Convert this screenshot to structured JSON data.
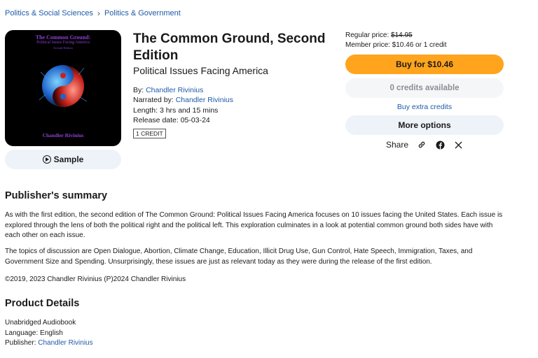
{
  "breadcrumb": [
    "Politics & Social Sciences",
    "Politics & Government"
  ],
  "cover": {
    "title_line1": "The Common Ground:",
    "title_line2": "Political Issues Facing America",
    "title_line3": "Second Edition",
    "author": "Chandler Rivinius"
  },
  "sample_label": "Sample",
  "book": {
    "title": "The Common Ground, Second Edition",
    "subtitle": "Political Issues Facing America",
    "by_label": "By: ",
    "author": "Chandler Rivinius",
    "narrated_label": "Narrated by: ",
    "narrator": "Chandler Rivinius",
    "length": "Length: 3 hrs and 15 mins",
    "release": "Release date: 05-03-24",
    "credit_badge": "1 CREDIT"
  },
  "pricing": {
    "regular_label": "Regular price: ",
    "regular_price": "$14.95",
    "member_price": "Member price: $10.46 or 1 credit",
    "buy_label": "Buy for $10.46",
    "credits_label": "0 credits available",
    "extra_credits_label": "Buy extra credits",
    "more_options_label": "More options",
    "share_label": "Share"
  },
  "summary": {
    "heading": "Publisher's summary",
    "p1": "As with the first edition, the second edition of The Common Ground: Political Issues Facing America focuses on 10 issues facing the United States. Each issue is explored through the lens of both the political right and the political left. This exploration culminates in a look at potential common ground both sides have with each other on each issue.",
    "p2": "The topics of discussion are Open Dialogue, Abortion, Climate Change, Education, Illicit Drug Use, Gun Control, Hate Speech, Immigration, Taxes, and Government Size and Spending. Unsurprisingly, these issues are just as relevant today as they were during the release of the first edition.",
    "copyright": "©2019, 2023 Chandler Rivinius (P)2024 Chandler Rivinius"
  },
  "details": {
    "heading": "Product Details",
    "format": "Unabridged Audiobook",
    "language": "Language: English",
    "publisher_label": "Publisher: ",
    "publisher": "Chandler Rivinius"
  },
  "icons": [
    "chevron-right-icon",
    "play-icon",
    "link-icon",
    "facebook-icon",
    "x-icon"
  ],
  "colors": {
    "buy_button": "#ffa41c",
    "link": "#1e5aa8",
    "pill_bg": "#eef3fa",
    "cover_text": "#8b3fd1"
  }
}
